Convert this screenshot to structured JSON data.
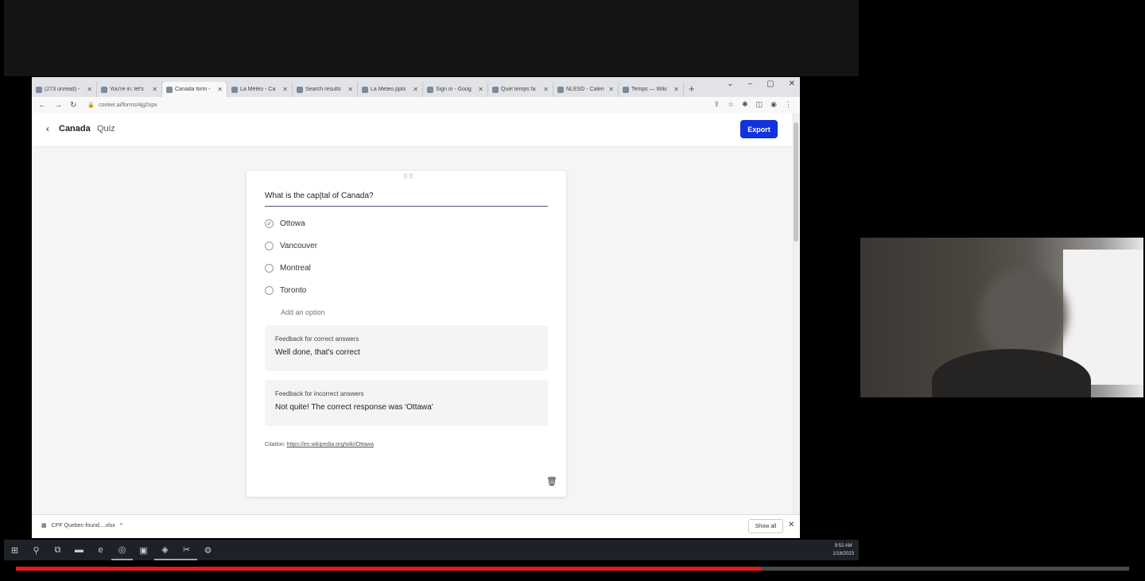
{
  "browser": {
    "tabs": [
      {
        "title": "(273 unread) -"
      },
      {
        "title": "You're in: let's"
      },
      {
        "title": "Canada form -",
        "active": true
      },
      {
        "title": "La Météo - Ca"
      },
      {
        "title": "Search results"
      },
      {
        "title": "La Meteo.pptx"
      },
      {
        "title": "Sign in - Goog"
      },
      {
        "title": "Quel temps fa"
      },
      {
        "title": "NLESD - Calen"
      },
      {
        "title": "Temps — Wiki"
      }
    ],
    "url": "conker.ai/forms/4jg2xpv"
  },
  "app": {
    "title": "Canada",
    "subtitle": "Quiz",
    "export_label": "Export"
  },
  "question": {
    "text": "What is the cap|tal of Canada?",
    "options": [
      {
        "label": "Ottowa",
        "selected": true
      },
      {
        "label": "Vancouver",
        "selected": false
      },
      {
        "label": "Montreal",
        "selected": false
      },
      {
        "label": "Toronto",
        "selected": false
      }
    ],
    "add_option": "Add an option",
    "feedback_correct": {
      "label": "Feedback for correct answers",
      "text": "Well done, that's correct"
    },
    "feedback_incorrect": {
      "label": "Feedback for incorrect answers",
      "text": "Not quite! The correct response was 'Ottawa'"
    },
    "citation_label": "Citation:",
    "citation_url": "https://en.wikipedia.org/wiki/Ottawa"
  },
  "downloads": {
    "file": "CPF Quebec-found....xlsx",
    "show_all": "Show all"
  },
  "taskbar": {
    "time": "9:52 AM",
    "date": "1/18/2023"
  },
  "video": {
    "progress": 0.67
  },
  "colors": {
    "accent": "#1133dd",
    "progress": "#e51a1a"
  }
}
